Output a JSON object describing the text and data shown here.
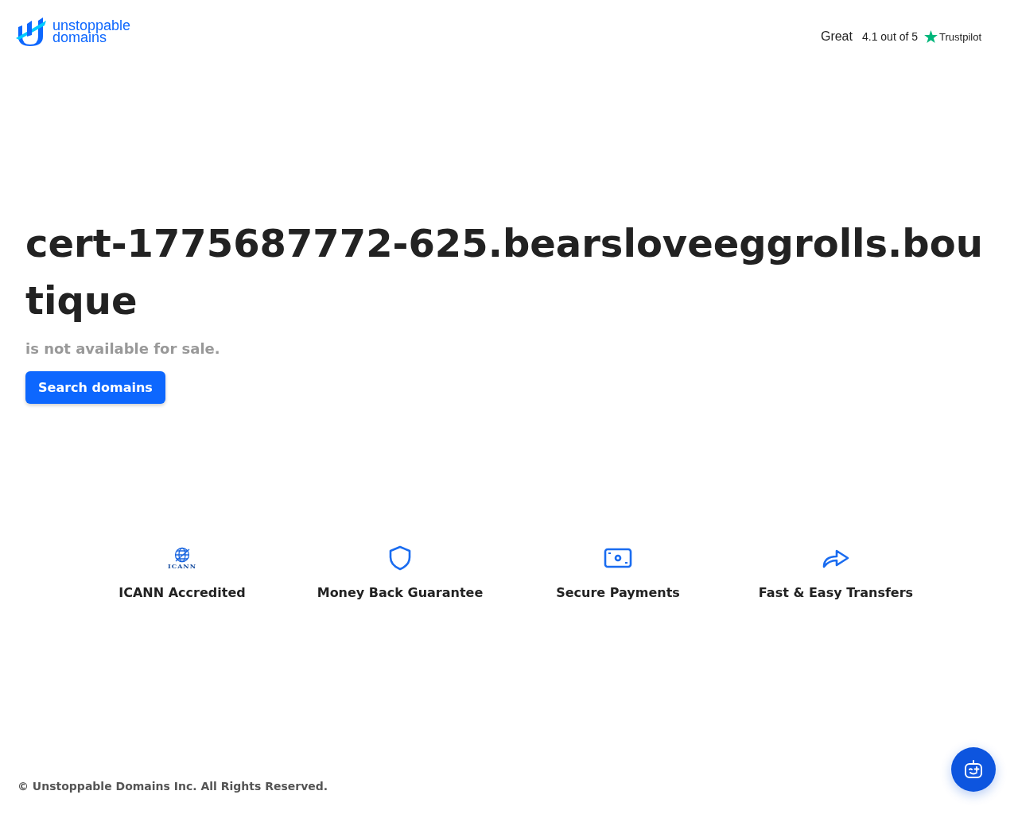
{
  "header": {
    "logo": {
      "line_1": "unstoppable",
      "line_2": "domains"
    },
    "rating": {
      "label": "Great",
      "score": "4.1 out of 5",
      "brand": "Trustpilot"
    }
  },
  "hero": {
    "domain": "cert-1775687772-625.bearsloveeggrolls.boutique",
    "status": "is not available for sale.",
    "button": "Search domains"
  },
  "features": [
    {
      "kind": "icann",
      "logo_text": "ICANN",
      "label": "ICANN Accredited"
    },
    {
      "kind": "shield",
      "label": "Money Back Guarantee"
    },
    {
      "kind": "money",
      "label": "Secure Payments"
    },
    {
      "kind": "share",
      "label": "Fast & Easy Transfers"
    }
  ],
  "footer": {
    "copyright": "© Unstoppable Domains Inc. All Rights Reserved."
  }
}
